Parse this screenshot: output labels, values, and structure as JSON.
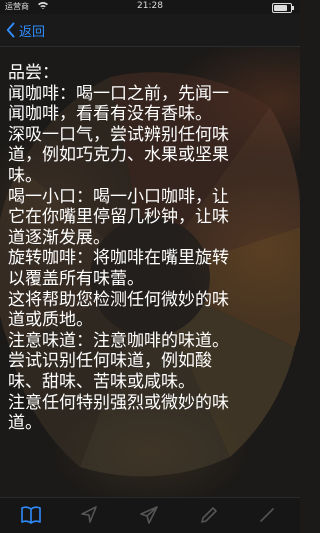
{
  "status_bar": {
    "carrier": "运营商",
    "time": "21:28",
    "battery_level": 0.9
  },
  "nav": {
    "back_label": "返回",
    "back_icon": "chevron-left-icon",
    "accent_color": "#2f8cff"
  },
  "content": {
    "lines": [
      "品尝：",
      "闻咖啡：喝一口之前，先闻一",
      "闻咖啡，看看有没有香味。",
      "深吸一口气，尝试辨别任何味",
      "道，例如巧克力、水果或坚果",
      "味。",
      "喝一小口：喝一小口咖啡，让",
      "它在你嘴里停留几秒钟，让味",
      "道逐渐发展。",
      "旋转咖啡：将咖啡在嘴里旋转",
      "以覆盖所有味蕾。",
      "这将帮助您检测任何微妙的味",
      "道或质地。",
      "注意味道：注意咖啡的味道。",
      "尝试识别任何味道，例如酸",
      "味、甜味、苦味或咸味。",
      "注意任何特别强烈或微妙的味",
      "道。"
    ]
  },
  "tab_bar": {
    "tabs": [
      {
        "icon": "book-icon",
        "active": true
      },
      {
        "icon": "navigation-arrow-icon",
        "active": false
      },
      {
        "icon": "send-icon",
        "active": false
      },
      {
        "icon": "pencil-icon",
        "active": false
      },
      {
        "icon": "edit-line-icon",
        "active": false
      }
    ],
    "active_color": "#2f8cff",
    "inactive_color": "#555555"
  }
}
